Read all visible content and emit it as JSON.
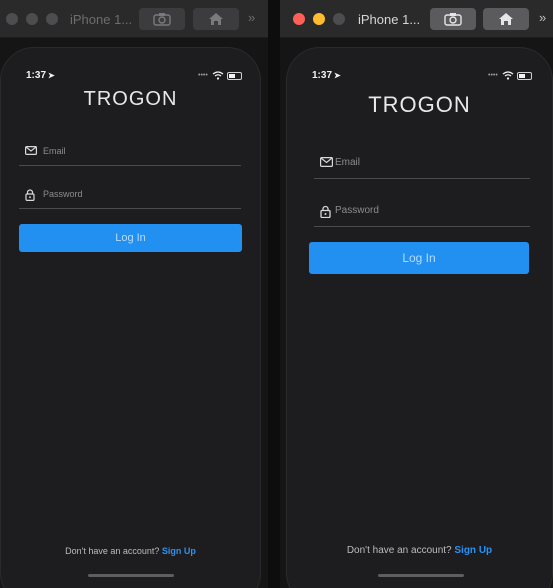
{
  "left_window": {
    "title": "iPhone 1...",
    "toolbar": {
      "screenshot_icon": "camera-icon",
      "home_icon": "home-icon",
      "more": "»"
    },
    "phone": {
      "status": {
        "time": "1:37",
        "location_glyph": "➤"
      },
      "logo": "TROGON",
      "email_placeholder": "Email",
      "password_placeholder": "Password",
      "login_label": "Log In",
      "signup_prompt": "Don't have an account?",
      "signup_link": "Sign Up"
    }
  },
  "right_window": {
    "title": "iPhone 1...",
    "toolbar": {
      "screenshot_icon": "camera-icon",
      "home_icon": "home-icon",
      "more": "»"
    },
    "phone": {
      "status": {
        "time": "1:37",
        "location_glyph": "➤"
      },
      "logo": "TROGON",
      "email_placeholder": "Email",
      "password_placeholder": "Password",
      "login_label": "Log In",
      "signup_prompt": "Don't have an account?",
      "signup_link": "Sign Up"
    }
  },
  "colors": {
    "accent": "#2290f1",
    "link": "#2a92f0",
    "phone_bg": "#1d1d1f"
  }
}
